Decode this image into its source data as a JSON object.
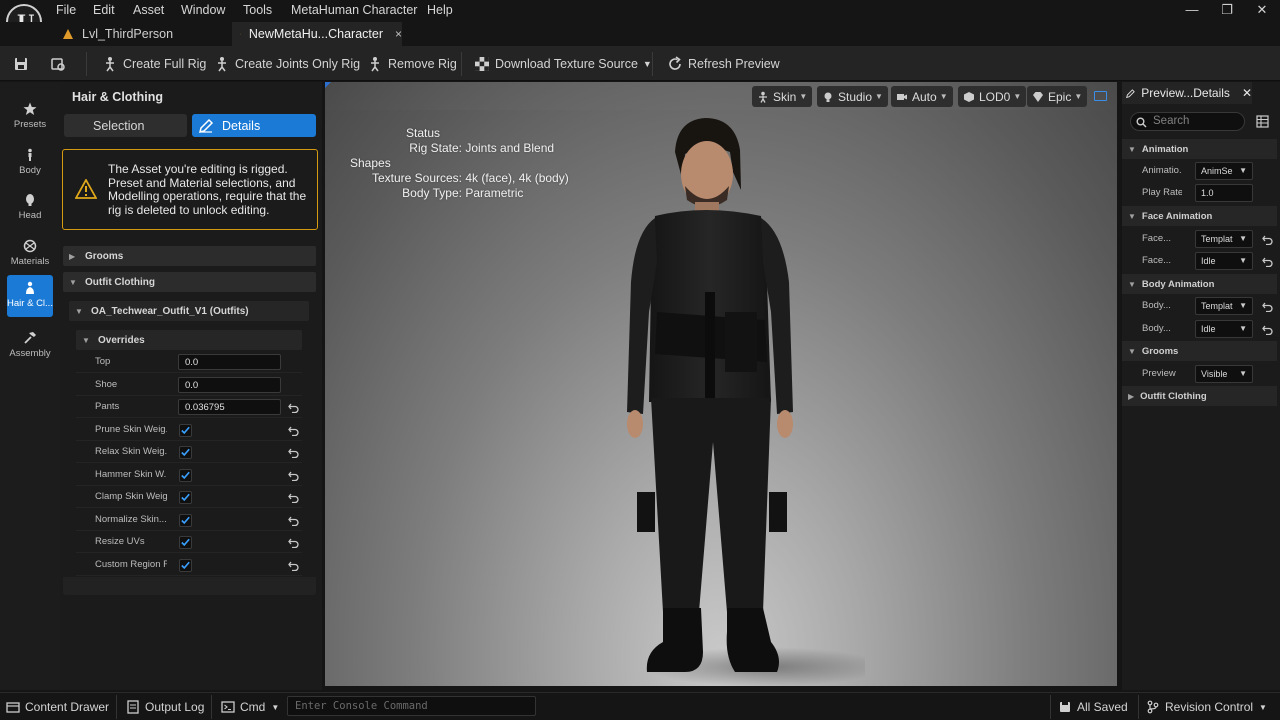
{
  "menu": {
    "items": [
      "File",
      "Edit",
      "Asset",
      "Window",
      "Tools",
      "MetaHuman Character",
      "Help"
    ]
  },
  "tabs": [
    {
      "label": "Lvl_ThirdPerson",
      "icon": "level-icon",
      "active": false
    },
    {
      "label": "NewMetaHu...Character",
      "icon": "metahuman-icon",
      "active": true,
      "close": "×"
    }
  ],
  "toolbar": {
    "create_full_rig": "Create Full Rig",
    "create_joints_rig": "Create Joints Only Rig",
    "remove_rig": "Remove Rig",
    "download_texture": "Download Texture Source",
    "refresh_preview": "Refresh Preview"
  },
  "modes": [
    {
      "label": "Presets",
      "icon": "star-icon"
    },
    {
      "label": "Body",
      "icon": "body-icon"
    },
    {
      "label": "Head",
      "icon": "head-icon"
    },
    {
      "label": "Materials",
      "icon": "materials-icon"
    },
    {
      "label": "Hair & Cl...",
      "icon": "hair-icon",
      "active": true
    },
    {
      "label": "Assembly",
      "icon": "hammer-icon"
    }
  ],
  "left_panel": {
    "title": "Hair & Clothing",
    "selection_label": "Selection",
    "details_label": "Details",
    "warning": "The Asset you're editing is rigged. Preset and Material selections, and Modelling operations, require that the rig is deleted to unlock editing.",
    "grooms_label": "Grooms",
    "outfit_label": "Outfit Clothing",
    "outfit_item": "OA_Techwear_Outfit_V1 (Outfits)",
    "overrides_label": "Overrides",
    "fields": [
      {
        "label": "Top",
        "value": "0.0"
      },
      {
        "label": "Shoe",
        "value": "0.0"
      },
      {
        "label": "Pants",
        "value": "0.036795"
      }
    ],
    "checks": [
      {
        "label": "Prune Skin Weig...",
        "checked": true
      },
      {
        "label": "Relax Skin Weig...",
        "checked": true
      },
      {
        "label": "Hammer Skin W...",
        "checked": true
      },
      {
        "label": "Clamp Skin Weig...",
        "checked": true
      },
      {
        "label": "Normalize Skin...",
        "checked": true
      },
      {
        "label": "Resize UVs",
        "checked": true
      },
      {
        "label": "Custom Region R...",
        "checked": true
      }
    ]
  },
  "viewport": {
    "buttons": {
      "skin": "Skin",
      "studio": "Studio",
      "auto": "Auto",
      "lod": "LOD0",
      "epic": "Epic"
    },
    "status": {
      "title": "Status",
      "rows": [
        {
          "label": "Rig State:",
          "value": "Joints and Blend Shapes"
        },
        {
          "label": "Texture Sources:",
          "value": "4k (face), 4k (body)"
        },
        {
          "label": "Body Type:",
          "value": "Parametric"
        }
      ]
    }
  },
  "right_panel": {
    "tab_label": "Preview...Details",
    "search_placeholder": "Search",
    "animation_label": "Animation",
    "animation_row": {
      "label": "Animatio...",
      "value": "AnimSe"
    },
    "play_rate": {
      "label": "Play Rate",
      "value": "1.0"
    },
    "face_animation_label": "Face Animation",
    "face_rows": [
      {
        "label": "Face...",
        "value": "Templat"
      },
      {
        "label": "Face...",
        "value": "Idle"
      }
    ],
    "body_animation_label": "Body Animation",
    "body_rows": [
      {
        "label": "Body...",
        "value": "Templat"
      },
      {
        "label": "Body...",
        "value": "Idle"
      }
    ],
    "grooms_label": "Grooms",
    "preview_row": {
      "label": "Preview",
      "value": "Visible"
    },
    "outfit_label": "Outfit Clothing"
  },
  "bottom": {
    "content_drawer": "Content Drawer",
    "output_log": "Output Log",
    "cmd": "Cmd",
    "console_placeholder": "Enter Console Command",
    "all_saved": "All Saved",
    "revision_control": "Revision Control"
  },
  "colors": {
    "accent": "#1a7ad6",
    "warning": "#d49a12"
  }
}
